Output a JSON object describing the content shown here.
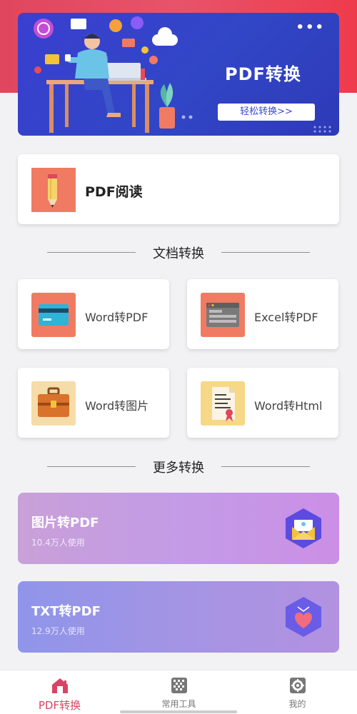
{
  "banner": {
    "title": "PDF转换",
    "button_label": "轻松转换>>",
    "more_dots": "•••"
  },
  "read_card": {
    "label": "PDF阅读"
  },
  "section_doc": {
    "title": "文档转换"
  },
  "doc_tools": [
    {
      "label": "Word转PDF",
      "icon": "credit-card-icon",
      "color": "#f07b62"
    },
    {
      "label": "Excel转PDF",
      "icon": "browser-window-icon",
      "color": "#f07b62"
    },
    {
      "label": "Word转图片",
      "icon": "briefcase-icon",
      "color": "#f5dca8"
    },
    {
      "label": "Word转Html",
      "icon": "certificate-document-icon",
      "color": "#f6d886"
    }
  ],
  "section_more": {
    "title": "更多转换"
  },
  "more_tools": [
    {
      "label": "图片转PDF",
      "usage": "10.4万人使用",
      "icon": "envelope-icon"
    },
    {
      "label": "TXT转PDF",
      "usage": "12.9万人使用",
      "icon": "heart-tag-icon"
    }
  ],
  "tabbar": {
    "tabs": [
      {
        "label": "PDF转换",
        "icon": "home-icon",
        "active": true
      },
      {
        "label": "常用工具",
        "icon": "tools-grid-icon",
        "active": false
      },
      {
        "label": "我的",
        "icon": "settings-gear-icon",
        "active": false
      }
    ]
  },
  "colors": {
    "accent": "#d74565",
    "banner_bg": "#3146c6",
    "top_gradient": "#e0465e"
  }
}
